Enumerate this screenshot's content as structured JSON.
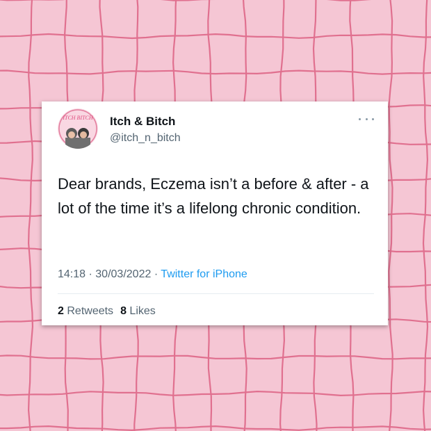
{
  "background": {
    "color": "#f5c6d4",
    "grid_line_color": "#e0708f"
  },
  "tweet": {
    "display_name": "Itch & Bitch",
    "handle": "@itch_n_bitch",
    "avatar_text": "ITCH BITCH",
    "text": "Dear brands, Eczema isn’t a before & after - a lot of the time it’s a lifelong chronic condition.",
    "time": "14:18",
    "date": "30/03/2022",
    "separator": "·",
    "source": "Twitter for iPhone",
    "retweets_count": "2",
    "retweets_label": "Retweets",
    "likes_count": "8",
    "likes_label": "Likes"
  }
}
